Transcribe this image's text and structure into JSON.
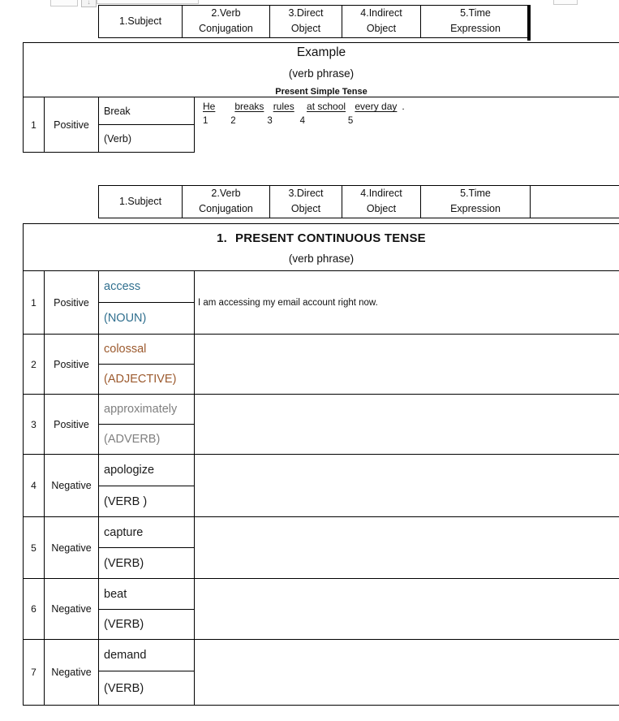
{
  "document": {
    "type": "word-processor-table-document",
    "columns_header": [
      {
        "line1": "1.Subject",
        "line2": ""
      },
      {
        "line1": "2.Verb",
        "line2": "Conjugation"
      },
      {
        "line1": "3.Direct",
        "line2": "Object"
      },
      {
        "line1": "4.Indirect",
        "line2": "Object"
      },
      {
        "line1": "5.Time",
        "line2": "Expression"
      }
    ],
    "example_block": {
      "heading": "Example",
      "subheading": "(verb phrase)",
      "tense_note": "Present Simple Tense",
      "row": {
        "index": "1",
        "polarity": "Positive",
        "lexeme": "Break",
        "pos": "(Verb)",
        "sentence_segments": [
          "He",
          "breaks",
          "rules",
          "at school",
          "every day"
        ],
        "sentence_terminator": ".",
        "segment_numbers": [
          "1",
          "2",
          "3",
          "4",
          "5"
        ]
      }
    },
    "main_block": {
      "title_number": "1.",
      "title": "PRESENT CONTINUOUS TENSE",
      "subtitle": "(verb phrase)",
      "rows": [
        {
          "index": "1",
          "polarity": "Positive",
          "lexeme": "access",
          "pos": "(NOUN)",
          "color": "#31708F",
          "sentence": "I am accessing my email account right now."
        },
        {
          "index": "2",
          "polarity": "Positive",
          "lexeme": "colossal",
          "pos": "(ADJECTIVE)",
          "color": "#9C5A2E",
          "sentence": ""
        },
        {
          "index": "3",
          "polarity": "Positive",
          "lexeme": "approximately",
          "pos": "(ADVERB)",
          "color": "#808080",
          "sentence": ""
        },
        {
          "index": "4",
          "polarity": "Negative",
          "lexeme": "apologize",
          "pos": "(VERB )",
          "color": "#1A1A1A",
          "sentence": ""
        },
        {
          "index": "5",
          "polarity": "Negative",
          "lexeme": "capture",
          "pos": "(VERB)",
          "color": "#1A1A1A",
          "sentence": ""
        },
        {
          "index": "6",
          "polarity": "Negative",
          "lexeme": "beat",
          "pos": "(VERB)",
          "color": "#1A1A1A",
          "sentence": ""
        },
        {
          "index": "7",
          "polarity": "Negative",
          "lexeme": "demand",
          "pos": "(VERB)",
          "color": "#1A1A1A",
          "sentence": ""
        }
      ]
    }
  }
}
